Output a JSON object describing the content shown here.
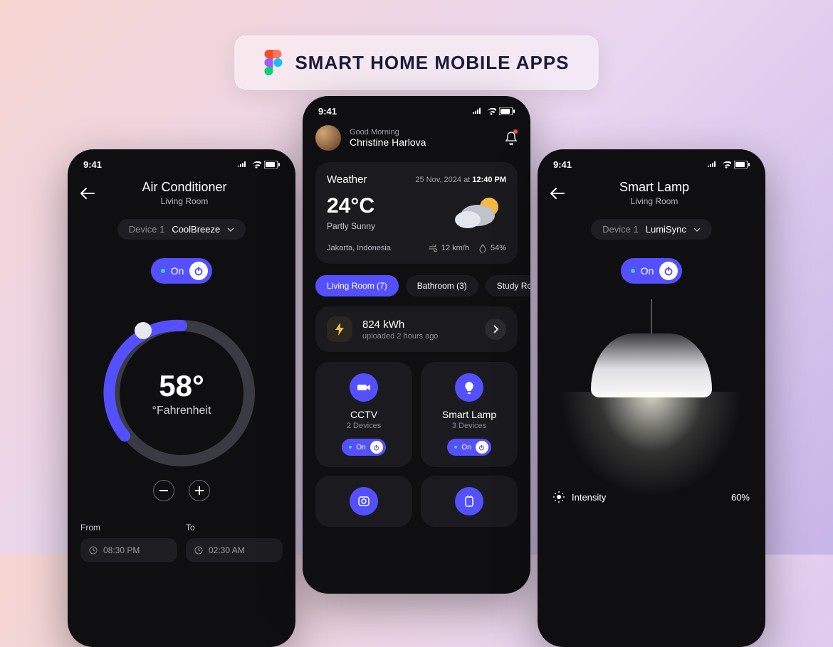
{
  "badge": {
    "title": "SMART HOME MOBILE APPS"
  },
  "status": {
    "time": "9:41"
  },
  "left": {
    "title": "Air Conditioner",
    "subtitle": "Living Room",
    "device_label": "Device 1",
    "device_name": "CoolBreeze",
    "power": "On",
    "temp": "58°",
    "unit": "°Fahrenheit",
    "from_label": "From",
    "to_label": "To",
    "from_val": "08:30 PM",
    "to_val": "02:30 AM"
  },
  "center": {
    "greeting_small": "Good Morning",
    "greeting_name": "Christine Harlova",
    "weather": {
      "title": "Weather",
      "date_prefix": "25 Nov, 2024 at ",
      "date_time": "12:40 PM",
      "temp": "24°C",
      "condition": "Partly Sunny",
      "location": "Jakarta, Indonesia",
      "wind": "12 km/h",
      "humidity": "54%"
    },
    "rooms": [
      {
        "label": "Living Room (7)",
        "active": true
      },
      {
        "label": "Bathroom (3)",
        "active": false
      },
      {
        "label": "Study Ro",
        "active": false
      }
    ],
    "energy": {
      "value": "824 kWh",
      "sub": "uploaded 2 hours ago"
    },
    "devices": [
      {
        "name": "CCTV",
        "count": "2 Devices",
        "state": "On"
      },
      {
        "name": "Smart Lamp",
        "count": "3 Devices",
        "state": "On"
      }
    ]
  },
  "right": {
    "title": "Smart Lamp",
    "subtitle": "Living Room",
    "device_label": "Device 1",
    "device_name": "LumiSync",
    "power": "On",
    "intensity_label": "Intensity",
    "intensity_value": "60%"
  },
  "colors": {
    "accent": "#5450ff"
  }
}
